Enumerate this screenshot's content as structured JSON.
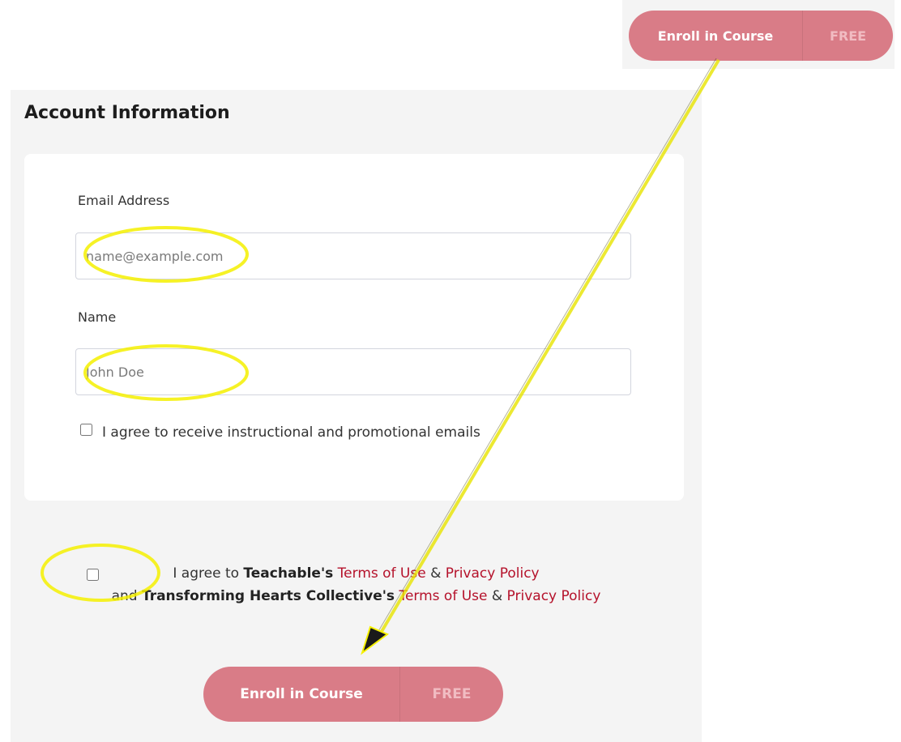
{
  "top_enroll": {
    "label": "Enroll in Course",
    "price": "FREE"
  },
  "account": {
    "title": "Account Information",
    "email": {
      "label": "Email Address",
      "placeholder": "name@example.com"
    },
    "name": {
      "label": "Name",
      "placeholder": "John Doe"
    },
    "marketing_checkbox_label": "I agree to receive instructional and promotional emails"
  },
  "terms": {
    "line1_prefix": "I agree to",
    "line1_company": "Teachable's",
    "terms_link": "Terms of Use",
    "amp": "&",
    "privacy_link": "Privacy Policy",
    "line2_prefix": "and",
    "line2_company": "Transforming Hearts Collective's"
  },
  "bottom_enroll": {
    "label": "Enroll in Course",
    "price": "FREE"
  },
  "colors": {
    "button_bg": "#d97c87",
    "link": "#b5122b",
    "annotation_highlight": "#f5f000"
  }
}
